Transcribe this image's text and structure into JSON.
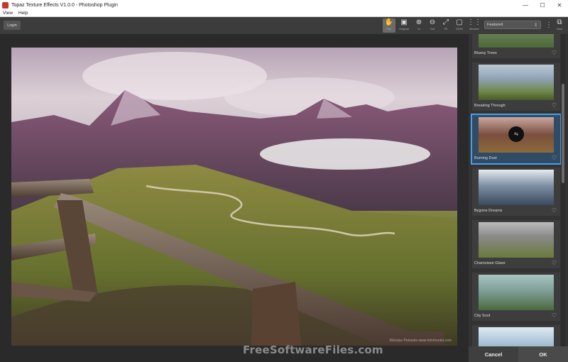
{
  "window": {
    "title": "Topaz Texture Effects V1.0.0 - Photoshop Plugin",
    "minimize": "—",
    "maximize": "☐",
    "close": "✕"
  },
  "menu": [
    "View",
    "Help"
  ],
  "toolbar": {
    "login_label": "Login",
    "tools": [
      {
        "name": "pan",
        "label": "Pan",
        "icon": "hand-icon",
        "glyph": "✋",
        "active": true
      },
      {
        "name": "original",
        "label": "Original",
        "icon": "image-icon",
        "glyph": "▣"
      },
      {
        "name": "zoom-in",
        "label": "In",
        "icon": "zoom-in-icon",
        "glyph": "⊕"
      },
      {
        "name": "zoom-out",
        "label": "Out",
        "icon": "zoom-out-icon",
        "glyph": "⊖"
      },
      {
        "name": "fit",
        "label": "Fit",
        "icon": "fit-icon",
        "glyph": "⤢"
      },
      {
        "name": "100",
        "label": "100%",
        "icon": "actual-size-icon",
        "glyph": "▢"
      },
      {
        "name": "browse",
        "label": "Browse",
        "icon": "grid-icon",
        "glyph": "⋮⋮"
      }
    ],
    "filter_select": "Featured",
    "new_label": "New"
  },
  "photo": {
    "credit": "Miroslav Petrasko  www.hdrshooter.com"
  },
  "presets": [
    {
      "name": "Bluesy Trees",
      "selected": false,
      "colors": [
        "#7e8a6e",
        "#4c6a3a"
      ]
    },
    {
      "name": "Breaking Through",
      "selected": false,
      "colors": [
        "#9fb3c8",
        "#6f8a4a"
      ]
    },
    {
      "name": "Burning Dust",
      "selected": true,
      "colors": [
        "#7a4e3e",
        "#c08a5a"
      ]
    },
    {
      "name": "Bygone Dreams",
      "selected": false,
      "colors": [
        "#7e8fa4",
        "#3a4a5c"
      ]
    },
    {
      "name": "Chamoisee Glaze",
      "selected": false,
      "colors": [
        "#8a8a8a",
        "#6a7a3a"
      ]
    },
    {
      "name": "City Soot",
      "selected": false,
      "colors": [
        "#7f9f98",
        "#4c6a3e"
      ]
    },
    {
      "name": "",
      "selected": false,
      "colors": [
        "#a7c3d6",
        "#6c8a5a"
      ]
    }
  ],
  "footer": {
    "cancel_label": "Cancel",
    "ok_label": "OK"
  },
  "watermark_brand": "FreeSoftwareFiles.com",
  "colors": {
    "accent": "#4aa0e6",
    "panel_bg": "#333333"
  }
}
